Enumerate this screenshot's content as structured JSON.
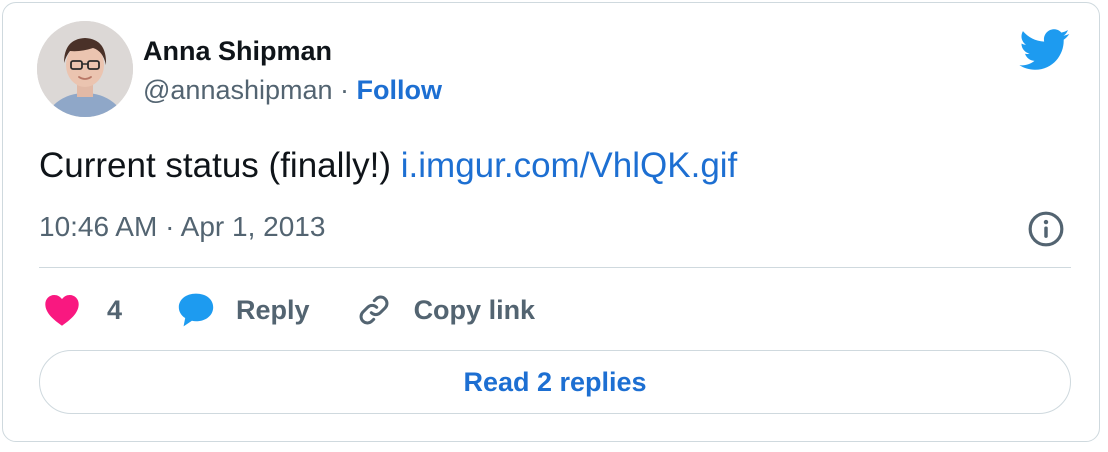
{
  "author": {
    "name": "Anna Shipman",
    "handle": "@annashipman",
    "separator": "·",
    "follow_label": "Follow"
  },
  "tweet": {
    "text": "Current status (finally!) ",
    "link_text": "i.imgur.com/VhlQK.gif",
    "timestamp": "10:46 AM · Apr 1, 2013"
  },
  "actions": {
    "like_count": "4",
    "reply_label": "Reply",
    "copy_link_label": "Copy link"
  },
  "read_replies_label": "Read 2 replies",
  "icons": {
    "brand": "twitter-bird-icon",
    "info": "info-icon",
    "like": "heart-icon",
    "reply": "speech-bubble-icon",
    "copy": "link-icon"
  },
  "colors": {
    "link": "#1d6fd2",
    "twitter_blue": "#1d9bf0",
    "like_pink": "#f91880",
    "muted_text": "#536471",
    "border": "#cfd9de"
  }
}
